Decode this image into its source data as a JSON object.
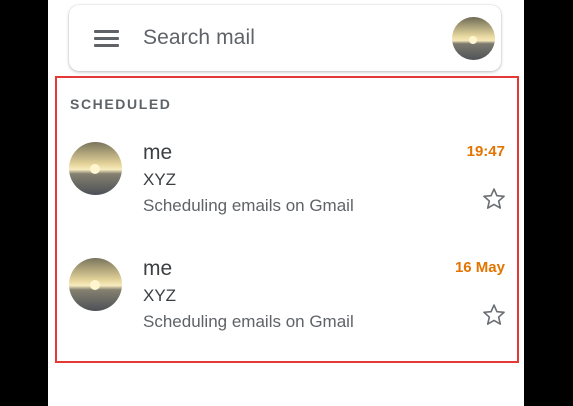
{
  "search": {
    "placeholder": "Search mail",
    "menu_icon": "hamburger-menu-icon",
    "account_avatar": "sunset-sea-photo"
  },
  "section": {
    "label": "SCHEDULED"
  },
  "emails": [
    {
      "sender": "me",
      "subject": "XYZ",
      "snippet": "Scheduling emails on Gmail",
      "time": "19:47",
      "starred": false,
      "avatar": "sunset-sea-photo"
    },
    {
      "sender": "me",
      "subject": "XYZ",
      "snippet": "Scheduling emails on Gmail",
      "time": "16 May",
      "starred": false,
      "avatar": "sunset-sea-photo"
    }
  ],
  "colors": {
    "time_accent": "#e37400",
    "highlight_border": "#e53935",
    "icon_gray": "#5f6368",
    "text_dark": "#3c4043",
    "background_outside": "#000000"
  }
}
